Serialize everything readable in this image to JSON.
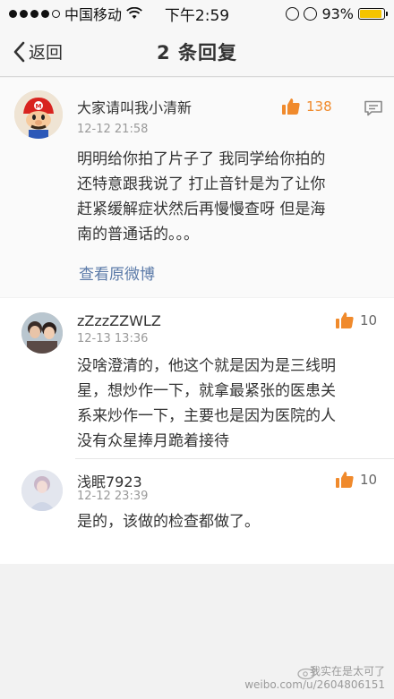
{
  "status_bar": {
    "carrier": "中国移动",
    "time": "下午2:59",
    "battery": "93%",
    "battery_level": 0.93
  },
  "nav": {
    "back_label": "返回",
    "title": "2 条回复"
  },
  "main_comment": {
    "user": "大家请叫我小清新",
    "time": "12-12 21:58",
    "likes": "138",
    "text_lines": [
      "明明给你拍了片子了 我同学给你拍的",
      "还特意跟我说了 打止音针是为了让你",
      "赶紧缓解症状然后再慢慢查呀 但是海",
      "南的普通话的。。。"
    ],
    "view_original": "查看原微博"
  },
  "replies": [
    {
      "user": "zZzzZZWLZ",
      "time": "12-13 13:36",
      "likes": "10",
      "text_lines": [
        "没啥澄清的，他这个就是因为是三线明",
        "星，想炒作一下，就拿最紧张的医患关",
        "系来炒作一下，主要也是因为医院的人",
        "没有众星捧月跪着接待"
      ]
    },
    {
      "user": "浅眠7923",
      "time": "12-12 23:39",
      "likes": "10",
      "text_lines": [
        "是的，该做的检查都做了。"
      ]
    }
  ],
  "watermark": {
    "line1": "我实在是太可了",
    "line2": "weibo.com/u/2604806151"
  },
  "colors": {
    "like_orange": "#f08a2c",
    "link_blue": "#5b7aa8",
    "battery_yellow": "#f5c400"
  }
}
